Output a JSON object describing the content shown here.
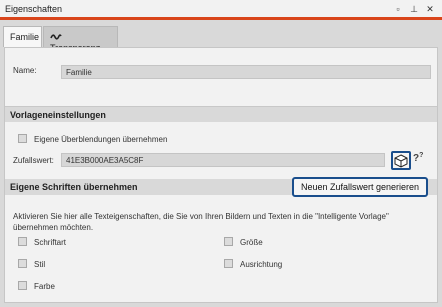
{
  "window": {
    "title": "Eigenschaften",
    "controls": [
      "▫",
      "⊥",
      "✕"
    ]
  },
  "tabs": [
    {
      "label": "Familie",
      "active": true
    },
    {
      "label": "Transparenz",
      "active": false,
      "icon": "transparency-icon"
    }
  ],
  "name_row": {
    "label": "Name:",
    "value": "Familie"
  },
  "vorlagen": {
    "heading": "Vorlageneinstellungen",
    "own_transitions": {
      "label": "Eigene Überblendungen übernehmen",
      "checked": false
    },
    "random_label": "Zufallswert:",
    "random_value": "41E3B000AE3A5C8F",
    "cube_icon": "dice-cube-icon",
    "help_label": "?"
  },
  "fonts": {
    "heading": "Eigene Schriften übernehmen",
    "generate_button": "Neuen Zufallswert generieren",
    "description": "Aktivieren Sie hier alle Texteigenschaften, die Sie von Ihren Bildern und Texten in die \"Intelligente Vorlage\" übernehmen möchten.",
    "options": [
      {
        "label": "Schriftart",
        "checked": false
      },
      {
        "label": "Größe",
        "checked": false
      },
      {
        "label": "Stil",
        "checked": false
      },
      {
        "label": "Ausrichtung",
        "checked": false
      },
      {
        "label": "Farbe",
        "checked": false
      }
    ]
  },
  "colors": {
    "accent": "#d9451b",
    "highlight_border": "#1a4e8c"
  }
}
